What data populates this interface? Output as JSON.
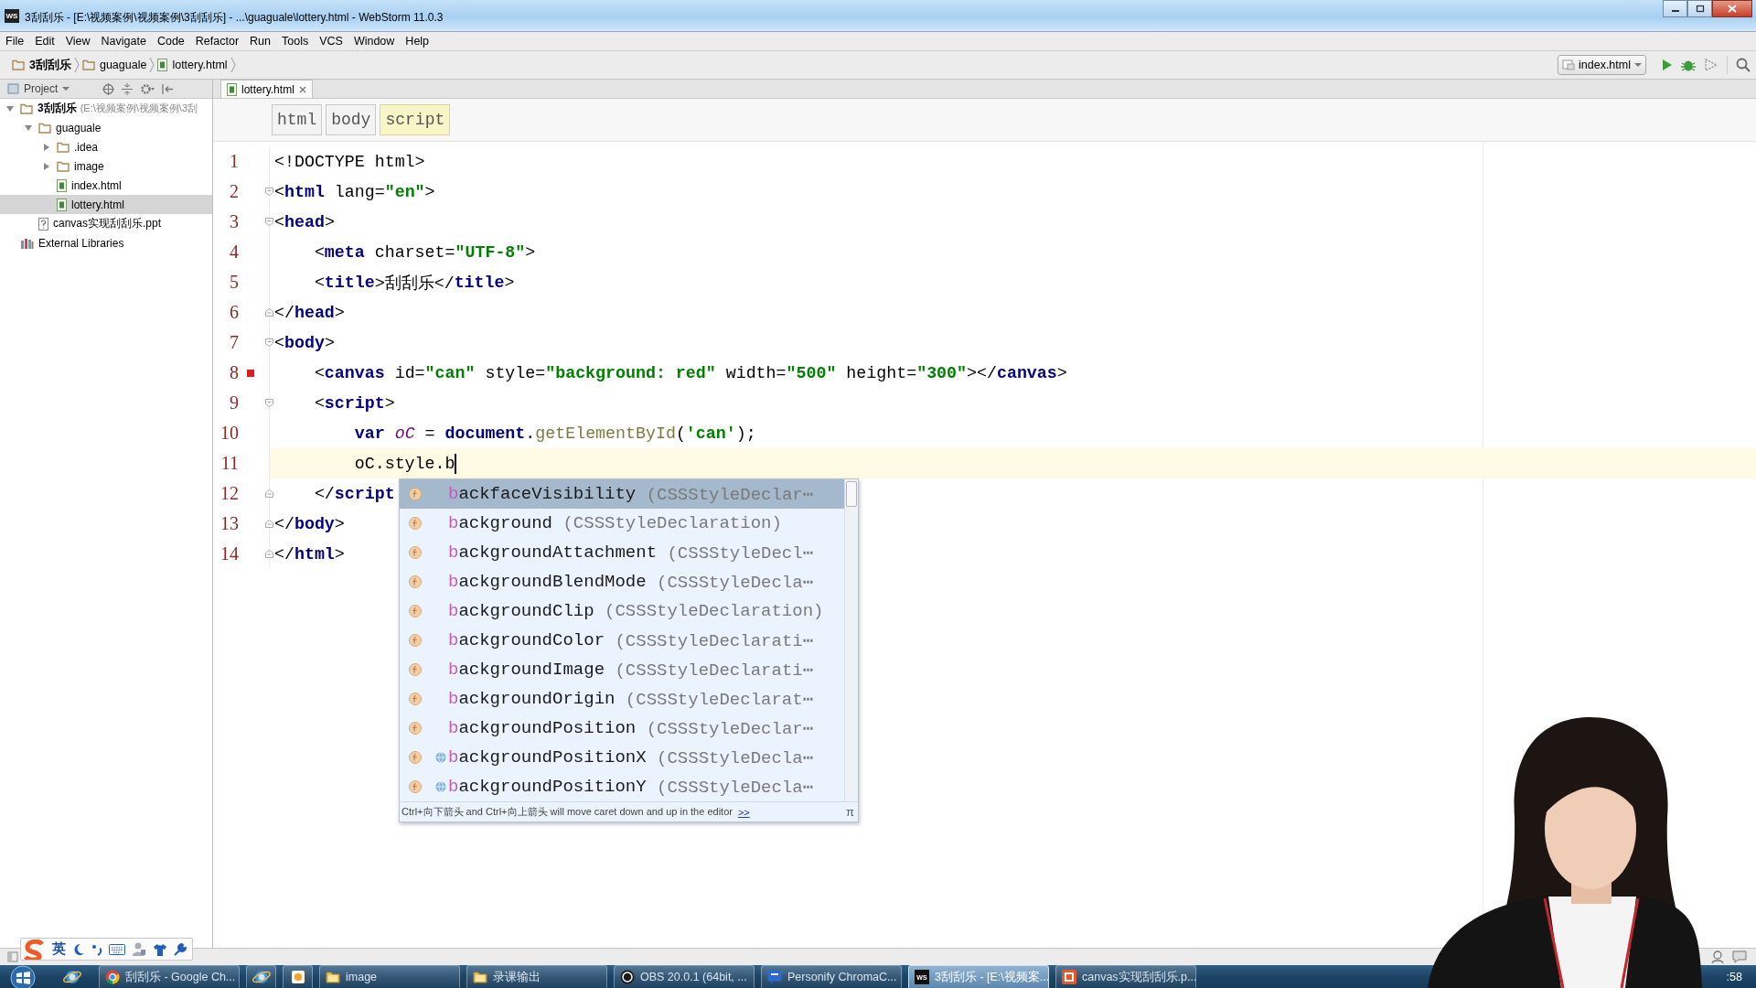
{
  "window": {
    "logo": "WS",
    "title": "3刮刮乐 - [E:\\视频案例\\视频案例\\3刮刮乐] - ...\\guaguale\\lottery.html - WebStorm 11.0.3"
  },
  "menu": [
    "File",
    "Edit",
    "View",
    "Navigate",
    "Code",
    "Refactor",
    "Run",
    "Tools",
    "VCS",
    "Window",
    "Help"
  ],
  "breadcrumbs": [
    {
      "label": "3刮刮乐",
      "kind": "project"
    },
    {
      "label": "guaguale",
      "kind": "folder"
    },
    {
      "label": "lottery.html",
      "kind": "file"
    }
  ],
  "run_config": "index.html",
  "project_panel": {
    "title": "Project",
    "tree": [
      {
        "label": "3刮刮乐",
        "detail": "(E:\\视频案例\\视频案例\\3刮",
        "kind": "project",
        "expanded": true,
        "selected": false,
        "children": [
          {
            "label": "guaguale",
            "kind": "folder",
            "expanded": true,
            "selected": false,
            "children": [
              {
                "label": ".idea",
                "kind": "folder",
                "expanded": false,
                "selected": false
              },
              {
                "label": "image",
                "kind": "folder",
                "expanded": false,
                "selected": false
              },
              {
                "label": "index.html",
                "kind": "html",
                "selected": false
              },
              {
                "label": "lottery.html",
                "kind": "html",
                "selected": true
              }
            ]
          },
          {
            "label": "canvas实现刮刮乐.ppt",
            "kind": "unknown",
            "selected": false
          }
        ]
      },
      {
        "label": "External Libraries",
        "kind": "library",
        "selected": false
      }
    ]
  },
  "editor": {
    "tabs": [
      {
        "label": "lottery.html",
        "selected": true
      }
    ],
    "tag_path": [
      {
        "label": "html",
        "selected": false
      },
      {
        "label": "body",
        "selected": false
      },
      {
        "label": "script",
        "selected": true
      }
    ],
    "lines": [
      {
        "number": "1",
        "fold_start": false,
        "fold_end": false,
        "breakpoint": false,
        "current": false,
        "tokens": [
          {
            "kind": "plain",
            "text": "<!DOCTYPE html>"
          }
        ]
      },
      {
        "number": "2",
        "fold_start": true,
        "fold_end": false,
        "breakpoint": false,
        "current": false,
        "tokens": [
          {
            "kind": "plain",
            "text": "<"
          },
          {
            "kind": "tag",
            "text": "html"
          },
          {
            "kind": "plain",
            "text": " lang="
          },
          {
            "kind": "value",
            "text": "\"en\""
          },
          {
            "kind": "plain",
            "text": ">"
          }
        ]
      },
      {
        "number": "3",
        "fold_start": true,
        "fold_end": false,
        "breakpoint": false,
        "current": false,
        "tokens": [
          {
            "kind": "plain",
            "text": "<"
          },
          {
            "kind": "tag",
            "text": "head"
          },
          {
            "kind": "plain",
            "text": ">"
          }
        ]
      },
      {
        "number": "4",
        "fold_start": false,
        "fold_end": false,
        "breakpoint": false,
        "current": false,
        "tokens": [
          {
            "kind": "plain",
            "text": "    <"
          },
          {
            "kind": "tag",
            "text": "meta"
          },
          {
            "kind": "plain",
            "text": " charset="
          },
          {
            "kind": "value",
            "text": "\"UTF-8\""
          },
          {
            "kind": "plain",
            "text": ">"
          }
        ]
      },
      {
        "number": "5",
        "fold_start": false,
        "fold_end": false,
        "breakpoint": false,
        "current": false,
        "tokens": [
          {
            "kind": "plain",
            "text": "    <"
          },
          {
            "kind": "tag",
            "text": "title"
          },
          {
            "kind": "plain",
            "text": ">刮刮乐</"
          },
          {
            "kind": "tag",
            "text": "title"
          },
          {
            "kind": "plain",
            "text": ">"
          }
        ]
      },
      {
        "number": "6",
        "fold_start": false,
        "fold_end": true,
        "breakpoint": false,
        "current": false,
        "tokens": [
          {
            "kind": "plain",
            "text": "</"
          },
          {
            "kind": "tag",
            "text": "head"
          },
          {
            "kind": "plain",
            "text": ">"
          }
        ]
      },
      {
        "number": "7",
        "fold_start": true,
        "fold_end": false,
        "breakpoint": false,
        "current": false,
        "tokens": [
          {
            "kind": "plain",
            "text": "<"
          },
          {
            "kind": "tag",
            "text": "body"
          },
          {
            "kind": "plain",
            "text": ">"
          }
        ]
      },
      {
        "number": "8",
        "fold_start": false,
        "fold_end": false,
        "breakpoint": true,
        "current": false,
        "tokens": [
          {
            "kind": "plain",
            "text": "    <"
          },
          {
            "kind": "tag",
            "text": "canvas"
          },
          {
            "kind": "plain",
            "text": " id="
          },
          {
            "kind": "value",
            "text": "\"can\""
          },
          {
            "kind": "plain",
            "text": " style="
          },
          {
            "kind": "value",
            "text": "\"background: red\""
          },
          {
            "kind": "plain",
            "text": " width="
          },
          {
            "kind": "value",
            "text": "\"500\""
          },
          {
            "kind": "plain",
            "text": " height="
          },
          {
            "kind": "value",
            "text": "\"300\""
          },
          {
            "kind": "plain",
            "text": "></"
          },
          {
            "kind": "tag",
            "text": "canvas"
          },
          {
            "kind": "plain",
            "text": ">"
          }
        ]
      },
      {
        "number": "9",
        "fold_start": true,
        "fold_end": false,
        "breakpoint": false,
        "current": false,
        "tokens": [
          {
            "kind": "plain",
            "text": "    <"
          },
          {
            "kind": "tag",
            "text": "script"
          },
          {
            "kind": "plain",
            "text": ">"
          }
        ]
      },
      {
        "number": "10",
        "fold_start": false,
        "fold_end": false,
        "breakpoint": false,
        "current": false,
        "tokens": [
          {
            "kind": "keyword",
            "text": "        var "
          },
          {
            "kind": "variable",
            "text": "oC"
          },
          {
            "kind": "plain",
            "text": " = "
          },
          {
            "kind": "keyword",
            "text": "document"
          },
          {
            "kind": "plain",
            "text": "."
          },
          {
            "kind": "method",
            "text": "getElementById"
          },
          {
            "kind": "plain",
            "text": "("
          },
          {
            "kind": "value",
            "text": "'can'"
          },
          {
            "kind": "plain",
            "text": ");"
          }
        ]
      },
      {
        "number": "11",
        "fold_start": false,
        "fold_end": false,
        "breakpoint": false,
        "current": true,
        "tokens": [
          {
            "kind": "plain",
            "text": "        oC.style.b"
          }
        ]
      },
      {
        "number": "12",
        "fold_start": false,
        "fold_end": true,
        "breakpoint": false,
        "current": false,
        "tokens": [
          {
            "kind": "plain",
            "text": "    </"
          },
          {
            "kind": "tag",
            "text": "script"
          }
        ]
      },
      {
        "number": "13",
        "fold_start": false,
        "fold_end": true,
        "breakpoint": false,
        "current": false,
        "tokens": [
          {
            "kind": "plain",
            "text": "</"
          },
          {
            "kind": "tag",
            "text": "body"
          },
          {
            "kind": "plain",
            "text": ">"
          }
        ]
      },
      {
        "number": "14",
        "fold_start": false,
        "fold_end": true,
        "breakpoint": false,
        "current": false,
        "tokens": [
          {
            "kind": "plain",
            "text": "</"
          },
          {
            "kind": "tag",
            "text": "html"
          },
          {
            "kind": "plain",
            "text": ">"
          }
        ]
      }
    ]
  },
  "completion": {
    "items": [
      {
        "match": "b",
        "rest": "ackfaceVisibility",
        "type": "(CSSStyleDeclar⋯",
        "kind": "property",
        "selected": true
      },
      {
        "match": "b",
        "rest": "ackground",
        "type": "(CSSStyleDeclaration)",
        "kind": "property",
        "selected": false
      },
      {
        "match": "b",
        "rest": "ackgroundAttachment",
        "type": "(CSSStyleDecl⋯",
        "kind": "property",
        "selected": false
      },
      {
        "match": "b",
        "rest": "ackgroundBlendMode",
        "type": "(CSSStyleDecla⋯",
        "kind": "property",
        "selected": false
      },
      {
        "match": "b",
        "rest": "ackgroundClip",
        "type": "(CSSStyleDeclaration)",
        "kind": "property",
        "selected": false
      },
      {
        "match": "b",
        "rest": "ackgroundColor",
        "type": "(CSSStyleDeclarati⋯",
        "kind": "property",
        "selected": false
      },
      {
        "match": "b",
        "rest": "ackgroundImage",
        "type": "(CSSStyleDeclarati⋯",
        "kind": "property",
        "selected": false
      },
      {
        "match": "b",
        "rest": "ackgroundOrigin",
        "type": "(CSSStyleDeclarat⋯",
        "kind": "property",
        "selected": false
      },
      {
        "match": "b",
        "rest": "ackgroundPosition",
        "type": "(CSSStyleDeclar⋯",
        "kind": "property",
        "selected": false
      },
      {
        "match": "b",
        "rest": "ackgroundPositionX",
        "type": "(CSSStyleDecla⋯",
        "kind": "web-property",
        "selected": false
      },
      {
        "match": "b",
        "rest": "ackgroundPositionY",
        "type": "(CSSStyleDecla⋯",
        "kind": "web-property",
        "selected": false
      }
    ],
    "hint": "Ctrl+向下箭头 and Ctrl+向上箭头 will move caret down and up in the editor",
    "link": ">>",
    "pin": "π"
  },
  "ime_toolbar": {
    "mode": "英"
  },
  "taskbar": {
    "items": [
      {
        "kind": "pinned"
      },
      {
        "kind": "browser",
        "label": "刮刮乐 - Google Ch...",
        "active": false
      },
      {
        "kind": "shortcut",
        "active": false
      },
      {
        "kind": "launcher",
        "active": false
      },
      {
        "kind": "folder",
        "label": "image",
        "active": false
      },
      {
        "kind": "folder",
        "label": "录课输出",
        "active": false
      },
      {
        "kind": "recorder",
        "label": "OBS 20.0.1 (64bit, ...",
        "active": false
      },
      {
        "kind": "chat",
        "label": "Personify ChromaC...",
        "active": false
      },
      {
        "kind": "ide",
        "icon_text": "WS",
        "label": "3刮刮乐 - [E:\\视频案...",
        "active": true
      },
      {
        "kind": "presentation",
        "label": "canvas实现刮刮乐.p...",
        "active": false
      }
    ],
    "clock": ":58"
  }
}
